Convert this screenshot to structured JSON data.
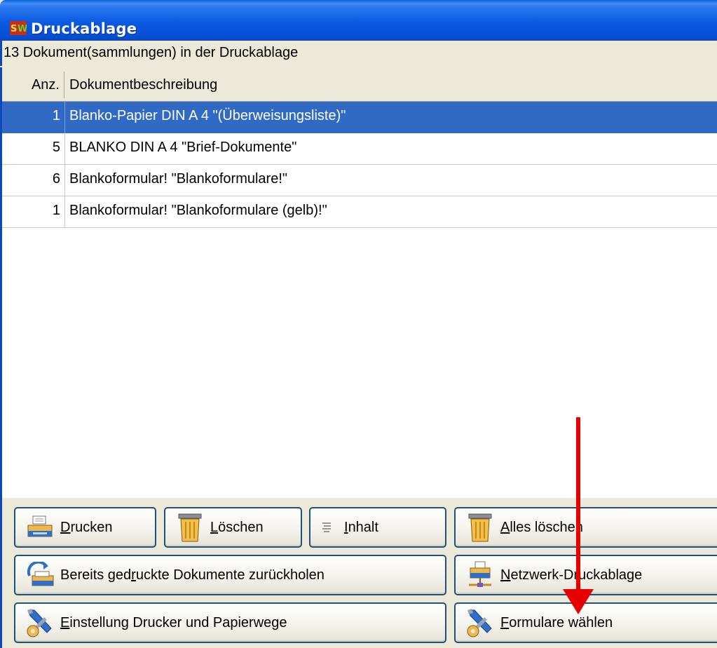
{
  "window": {
    "title": "Druckablage",
    "app_icon": "sw-app-icon"
  },
  "info": {
    "text": "13 Dokument(sammlungen) in der Druckablage"
  },
  "list": {
    "columns": [
      "Anz.",
      "Dokumentbeschreibung"
    ],
    "rows": [
      {
        "anz": "1",
        "desc": "Blanko-Papier DIN A 4 \"(Überweisungsliste)\"",
        "selected": true
      },
      {
        "anz": "5",
        "desc": "BLANKO DIN A 4 \"Brief-Dokumente\"",
        "selected": false
      },
      {
        "anz": "6",
        "desc": "Blankoformular! \"Blankoformulare!\"",
        "selected": false
      },
      {
        "anz": "1",
        "desc": "Blankoformular! \"Blankoformulare (gelb)!\"",
        "selected": false
      }
    ]
  },
  "buttons": {
    "drucken": {
      "pre": "",
      "acc": "D",
      "post": "rucken",
      "icon": "printer-icon"
    },
    "loeschen": {
      "pre": "",
      "acc": "L",
      "post": "öschen",
      "icon": "trash-icon"
    },
    "inhalt": {
      "pre": "",
      "acc": "I",
      "post": "nhalt",
      "icon": "document-lines-icon"
    },
    "alles_loeschen": {
      "pre": "",
      "acc": "A",
      "post": "lles löschen",
      "icon": "trash-icon"
    },
    "zurueckholen": {
      "pre": "Bereits ged",
      "acc": "r",
      "post": "uckte Dokumente zurückholen",
      "icon": "printer-recycle-icon"
    },
    "netzwerk": {
      "pre": "",
      "acc": "N",
      "post": "etzwerk-Druckablage",
      "icon": "network-printer-icon"
    },
    "einstellung": {
      "pre": "",
      "acc": "E",
      "post": "instellung Drucker und Papierwege",
      "icon": "tools-icon"
    },
    "formulare": {
      "pre": "",
      "acc": "F",
      "post": "ormulare wählen",
      "icon": "tools-icon"
    }
  },
  "colors": {
    "titlebar": "#0b5ae0",
    "selection": "#316ac5",
    "annotation_arrow": "#e60000"
  }
}
